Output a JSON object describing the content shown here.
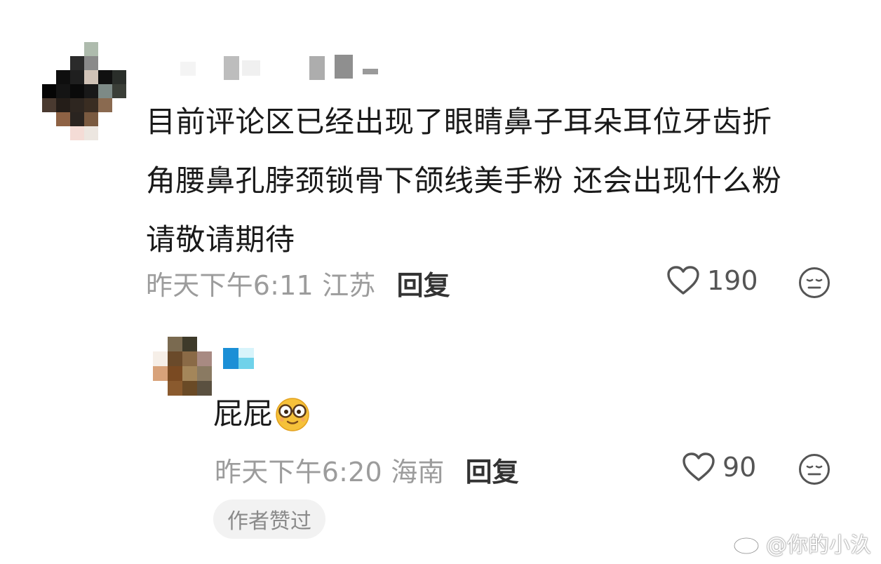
{
  "comments": [
    {
      "text": "目前评论区已经出现了眼睛鼻子耳朵耳位牙齿折\n角腰鼻孔脖颈锁骨下颌线美手粉 还会出现什么粉\n请敬请期待",
      "meta": "昨天下午6:11 江苏",
      "reply_label": "回复",
      "likes": "190",
      "avatar_icon": "pixelated-avatar",
      "username_icon": "blurred-username"
    },
    {
      "text": "屁屁",
      "emoji": "nerd-glasses-emoji",
      "meta": "昨天下午6:20 海南",
      "reply_label": "回复",
      "likes": "90",
      "badge": "作者赞过",
      "avatar_icon": "pixelated-avatar",
      "username_icon": "blurred-username"
    }
  ],
  "icons": {
    "like": "heart-outline-icon",
    "dislike": "meh-face-icon"
  },
  "watermark": {
    "text": "@你的小汣",
    "icon": "weibo-logo-icon"
  },
  "colors": {
    "meta_text": "#9c9c9c",
    "body_text": "#1a1a1a",
    "badge_bg": "#f2f2f2"
  }
}
